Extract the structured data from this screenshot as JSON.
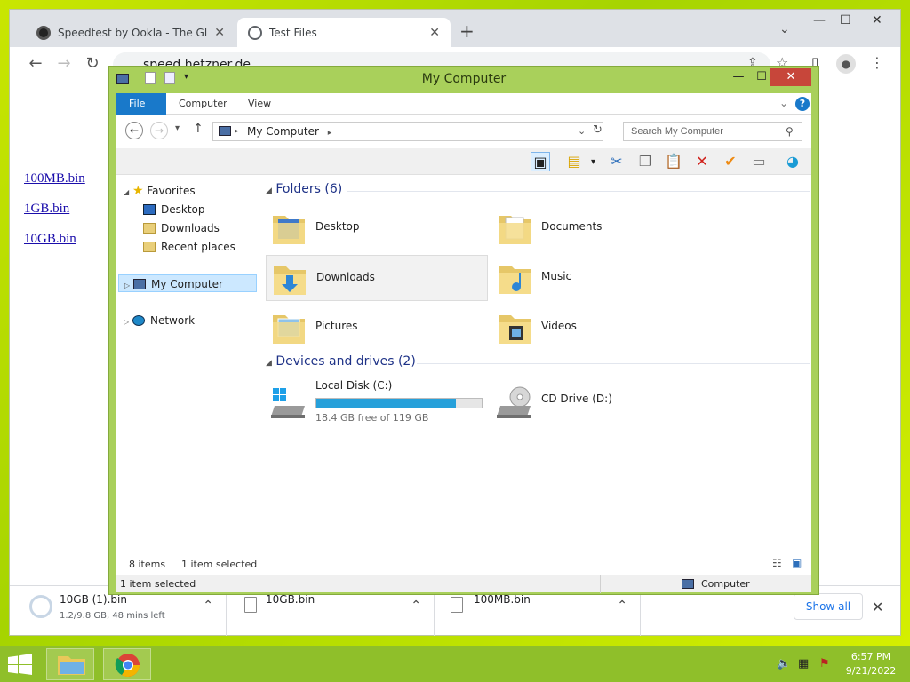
{
  "browser": {
    "tabs": [
      {
        "title": "Speedtest by Ookla - The Global"
      },
      {
        "title": "Test Files"
      }
    ],
    "new_tab": "+",
    "url": "speed.hetzner.de",
    "page_links": [
      "100MB.bin",
      "1GB.bin",
      "10GB.bin"
    ],
    "downloads": [
      {
        "name": "10GB (1).bin",
        "status": "1.2/9.8 GB, 48 mins left"
      },
      {
        "name": "10GB.bin",
        "status": ""
      },
      {
        "name": "100MB.bin",
        "status": ""
      }
    ],
    "show_all": "Show all"
  },
  "explorer": {
    "title": "My Computer",
    "ribbon_tabs": [
      "File",
      "Computer",
      "View"
    ],
    "address": "My Computer",
    "search_placeholder": "Search My Computer",
    "nav": {
      "favorites": "Favorites",
      "favorite_items": [
        "Desktop",
        "Downloads",
        "Recent places"
      ],
      "computer": "My Computer",
      "network": "Network"
    },
    "folders_header": "Folders (6)",
    "folders": [
      "Desktop",
      "Documents",
      "Downloads",
      "Music",
      "Pictures",
      "Videos"
    ],
    "drives_header": "Devices and drives (2)",
    "drives": [
      {
        "name": "Local Disk (C:)",
        "free": "18.4 GB free of 119 GB",
        "used_fraction": 0.845
      },
      {
        "name": "CD Drive (D:)"
      }
    ],
    "status_items": "8 items",
    "status_selected": "1 item selected",
    "bottom_selected": "1 item selected",
    "bottom_location": "Computer"
  },
  "taskbar": {
    "time": "6:57 PM",
    "date": "9/21/2022"
  },
  "colors": {
    "desktop": "#b8dd10",
    "window_frame": "#a9d05b",
    "file_tab": "#1979ca",
    "drive_fill": "#26a0da",
    "close_button": "#c7463a"
  }
}
